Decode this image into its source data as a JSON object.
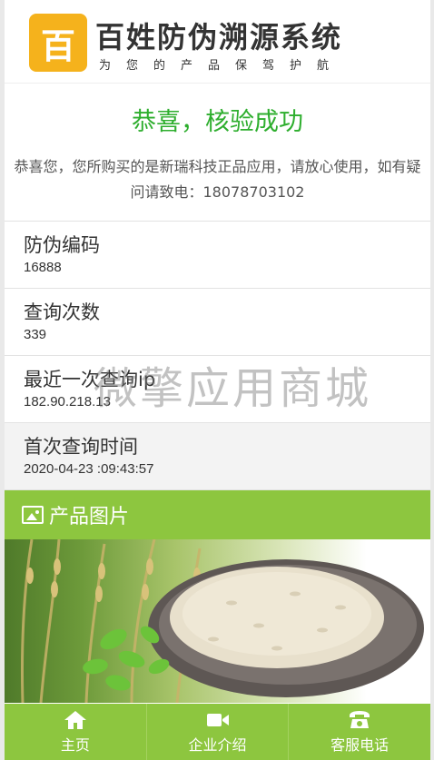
{
  "header": {
    "logo_char": "百",
    "title": "百姓防伪溯源系统",
    "slogan": "为您的产品保驾护航"
  },
  "result": {
    "title": "恭喜，核验成功",
    "message": "恭喜您，您所购买的是新瑞科技正品应用，请放心使用，如有疑问请致电：18078703102"
  },
  "info": [
    {
      "label": "防伪编码",
      "value": "16888"
    },
    {
      "label": "查询次数",
      "value": "339"
    },
    {
      "label": "最近一次查询ip",
      "value": "182.90.218.13"
    },
    {
      "label": "首次查询时间",
      "value": "2020-04-23 :09:43:57"
    }
  ],
  "watermark": "微擎应用商城",
  "product": {
    "section_title": "产品图片",
    "icon": "image-icon"
  },
  "nav": [
    {
      "label": "主页",
      "icon": "home-icon"
    },
    {
      "label": "企业介绍",
      "icon": "video-icon"
    },
    {
      "label": "客服电话",
      "icon": "phone-icon"
    }
  ],
  "colors": {
    "brand_green": "#8dc63f",
    "success_green": "#2eae2e",
    "logo_yellow": "#f5b21c"
  }
}
